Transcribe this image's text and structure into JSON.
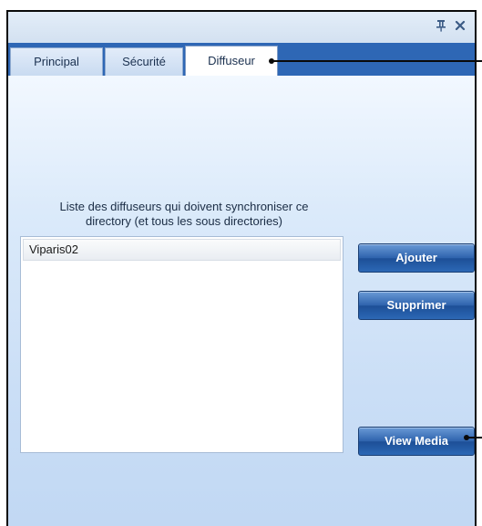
{
  "titlebar": {
    "pin_icon": "pin-icon",
    "pin_glyph": "↕",
    "close_icon": "close-icon",
    "close_glyph": "✕"
  },
  "tabs": [
    {
      "label": "Principal",
      "active": false
    },
    {
      "label": "Sécurité",
      "active": false
    },
    {
      "label": "Diffuseur",
      "active": true
    }
  ],
  "main": {
    "description_line1": "Liste des diffuseurs qui doivent synchroniser ce",
    "description_line2": "directory (et tous les sous directories)",
    "list_items": [
      "Viparis02"
    ],
    "buttons": {
      "add": "Ajouter",
      "remove": "Supprimer",
      "view_media": "View Media"
    }
  },
  "colors": {
    "tabstrip": "#2e67b5",
    "button": "#2c68b5"
  }
}
